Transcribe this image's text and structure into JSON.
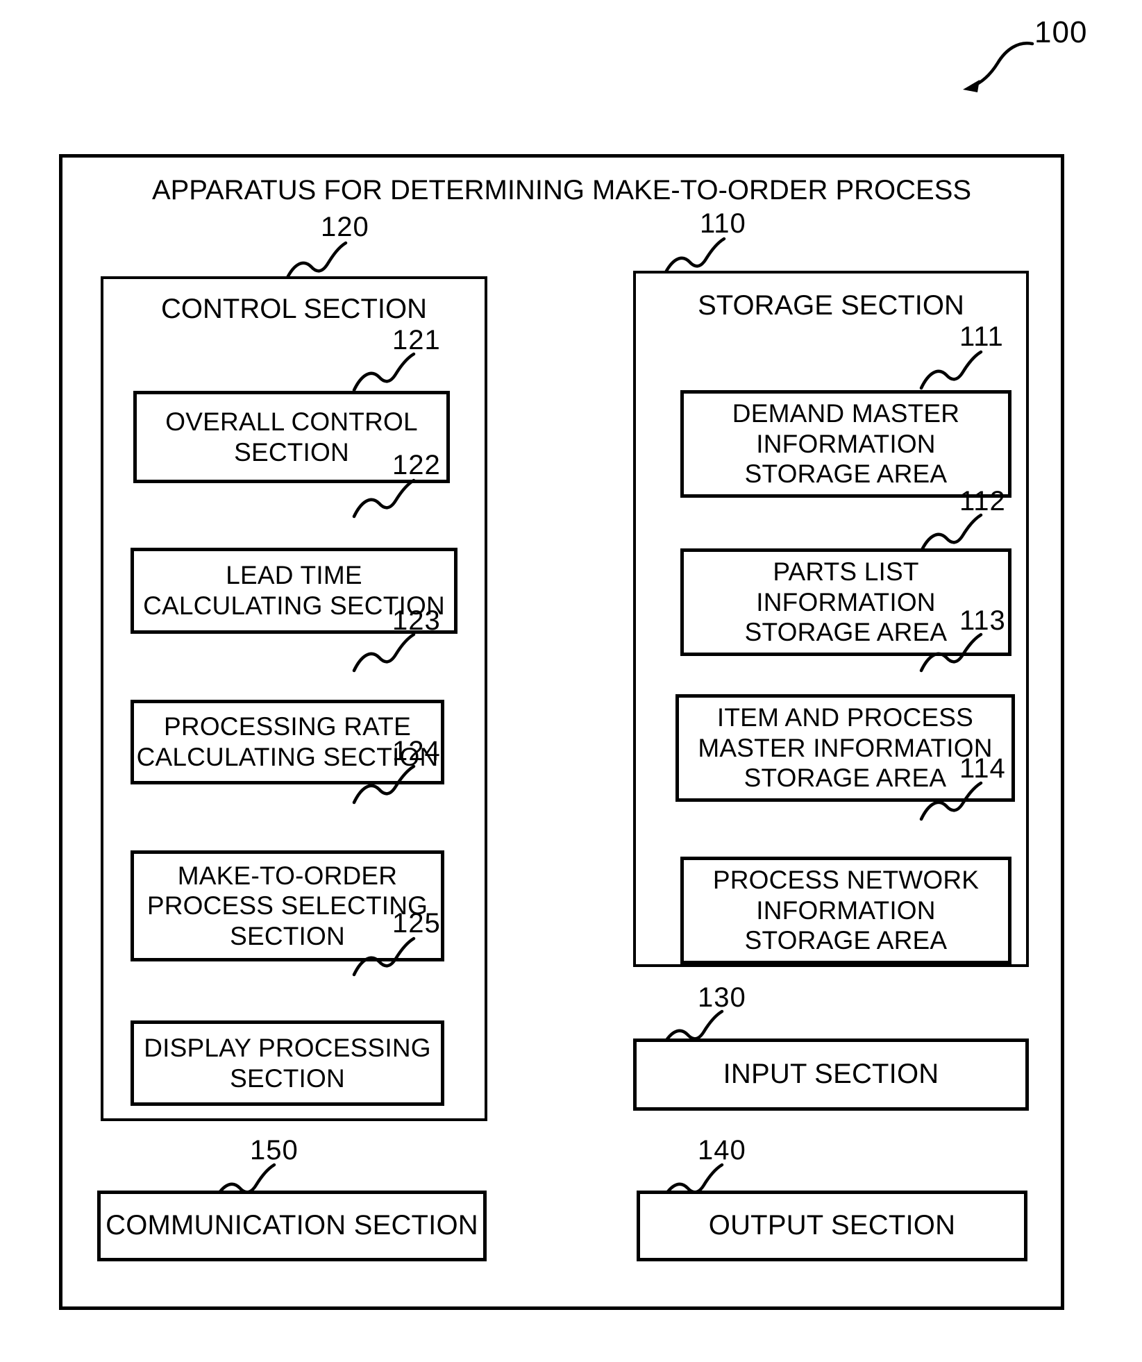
{
  "figure": {
    "main_ref": "100",
    "apparatus_title": "APPARATUS FOR DETERMINING MAKE-TO-ORDER PROCESS"
  },
  "control_section": {
    "ref": "120",
    "title": "CONTROL SECTION",
    "items": [
      {
        "ref": "121",
        "label": "OVERALL CONTROL\nSECTION"
      },
      {
        "ref": "122",
        "label": "LEAD TIME\nCALCULATING SECTION"
      },
      {
        "ref": "123",
        "label": "PROCESSING RATE\nCALCULATING SECTION"
      },
      {
        "ref": "124",
        "label": "MAKE-TO-ORDER\nPROCESS SELECTING\nSECTION"
      },
      {
        "ref": "125",
        "label": "DISPLAY PROCESSING\nSECTION"
      }
    ]
  },
  "storage_section": {
    "ref": "110",
    "title": "STORAGE SECTION",
    "items": [
      {
        "ref": "111",
        "label": "DEMAND MASTER\nINFORMATION\nSTORAGE AREA"
      },
      {
        "ref": "112",
        "label": "PARTS LIST\nINFORMATION\nSTORAGE AREA"
      },
      {
        "ref": "113",
        "label": "ITEM AND PROCESS\nMASTER INFORMATION\nSTORAGE AREA"
      },
      {
        "ref": "114",
        "label": "PROCESS NETWORK\nINFORMATION\nSTORAGE AREA"
      }
    ]
  },
  "input_section": {
    "ref": "130",
    "label": "INPUT SECTION"
  },
  "output_section": {
    "ref": "140",
    "label": "OUTPUT SECTION"
  },
  "communication_section": {
    "ref": "150",
    "label": "COMMUNICATION SECTION"
  }
}
